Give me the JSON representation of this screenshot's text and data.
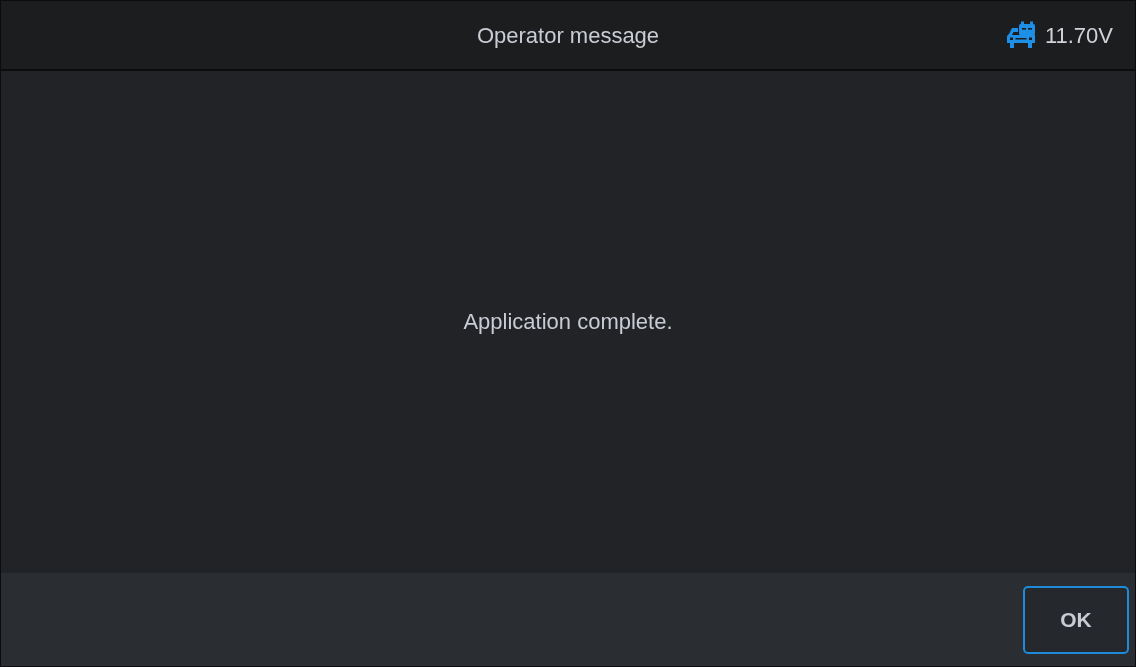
{
  "header": {
    "title": "Operator message",
    "voltage": "11.70V"
  },
  "message": "Application complete.",
  "buttons": [
    {
      "label": "OK",
      "focused": true
    }
  ]
}
